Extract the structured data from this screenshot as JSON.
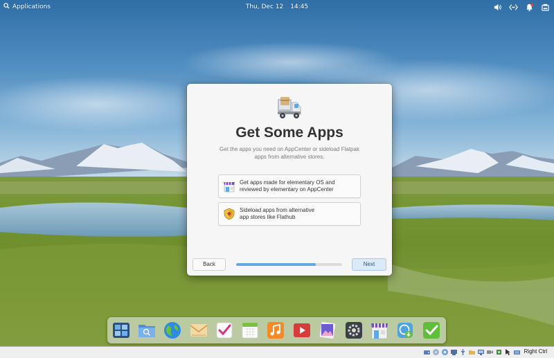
{
  "panel": {
    "applications_label": "Applications",
    "date": "Thu, Dec 12",
    "time": "14:45",
    "indicators": [
      "volume-icon",
      "network-icon",
      "notifications-icon",
      "power-icon"
    ]
  },
  "dialog": {
    "title": "Get Some Apps",
    "description": "Get the apps you need on AppCenter or sideload Flatpak apps from alternative stores.",
    "options": [
      {
        "label": "Get apps made for elementary OS and\nreviewed by elementary on AppCenter",
        "icon": "appcenter-icon"
      },
      {
        "label": "Sideload apps from alternative\napp stores like Flathub",
        "icon": "sideload-shield-icon"
      }
    ],
    "back_label": "Back",
    "next_label": "Next",
    "progress_percent": 75,
    "hero_icon": "delivery-truck-icon"
  },
  "dock": {
    "items": [
      "multitasking-view-icon",
      "files-icon",
      "web-browser-icon",
      "mail-icon",
      "tasks-icon",
      "calendar-icon",
      "music-icon",
      "videos-icon",
      "photos-icon",
      "system-settings-icon",
      "appcenter-icon",
      "software-update-icon",
      "onboarding-icon"
    ]
  },
  "host": {
    "key_label": "Right Ctrl"
  },
  "colors": {
    "accent": "#5fa8e6",
    "suggested_button": "#dbeaf8",
    "dialog_bg": "#f6f6f6"
  }
}
